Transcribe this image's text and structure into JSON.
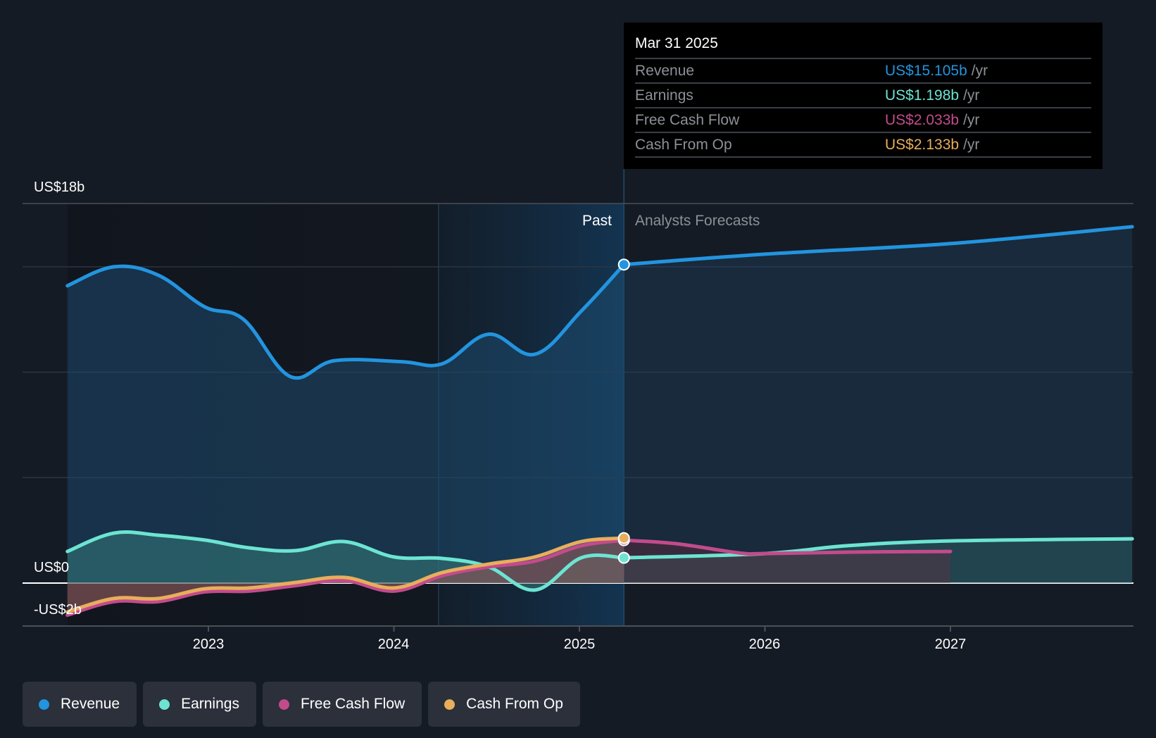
{
  "chart_data": {
    "type": "area",
    "title": "",
    "xlabel": "",
    "ylabel": "",
    "ylim": [
      -2,
      18
    ],
    "xlim": [
      2022.24,
      2027.98
    ],
    "y_ticks": [
      {
        "value": 18,
        "label": "US$18b"
      },
      {
        "value": 0,
        "label": "US$0"
      },
      {
        "value": -2,
        "label": "-US$2b"
      }
    ],
    "gridlines": [
      15,
      10,
      5
    ],
    "x_ticks": [
      {
        "value": 2023,
        "label": "2023"
      },
      {
        "value": 2024,
        "label": "2024"
      },
      {
        "value": 2025,
        "label": "2025"
      },
      {
        "value": 2026,
        "label": "2026"
      },
      {
        "value": 2027,
        "label": "2027"
      }
    ],
    "past_label": "Past",
    "forecast_label": "Analysts Forecasts",
    "past_end": 2025.24,
    "highlight_start": 2024.24,
    "legend_position": "bottom-left",
    "series": [
      {
        "name": "Revenue",
        "color": "#2394df",
        "past": [
          [
            2022.24,
            14.1
          ],
          [
            2022.49,
            15.0
          ],
          [
            2022.73,
            14.6
          ],
          [
            2022.98,
            13.1
          ],
          [
            2023.19,
            12.5
          ],
          [
            2023.44,
            9.8
          ],
          [
            2023.68,
            10.55
          ],
          [
            2024.04,
            10.5
          ],
          [
            2024.26,
            10.4
          ],
          [
            2024.51,
            11.8
          ],
          [
            2024.76,
            10.85
          ],
          [
            2025.01,
            12.9
          ],
          [
            2025.24,
            15.105
          ]
        ],
        "forecast": [
          [
            2025.24,
            15.105
          ],
          [
            2026.0,
            15.6
          ],
          [
            2027.0,
            16.1
          ],
          [
            2027.98,
            16.9
          ]
        ]
      },
      {
        "name": "Earnings",
        "color": "#6de4d2",
        "past": [
          [
            2022.24,
            1.5
          ],
          [
            2022.49,
            2.37
          ],
          [
            2022.73,
            2.27
          ],
          [
            2022.98,
            2.04
          ],
          [
            2023.22,
            1.67
          ],
          [
            2023.47,
            1.54
          ],
          [
            2023.73,
            1.97
          ],
          [
            2024.0,
            1.24
          ],
          [
            2024.26,
            1.17
          ],
          [
            2024.51,
            0.77
          ],
          [
            2024.76,
            -0.33
          ],
          [
            2025.01,
            1.2
          ],
          [
            2025.24,
            1.198
          ]
        ],
        "forecast": [
          [
            2025.24,
            1.198
          ],
          [
            2026.0,
            1.4
          ],
          [
            2026.44,
            1.77
          ],
          [
            2027.0,
            2.0
          ],
          [
            2027.98,
            2.1
          ]
        ]
      },
      {
        "name": "Free Cash Flow",
        "color": "#c24b8c",
        "past": [
          [
            2022.24,
            -1.52
          ],
          [
            2022.49,
            -0.88
          ],
          [
            2022.73,
            -0.88
          ],
          [
            2022.98,
            -0.42
          ],
          [
            2023.22,
            -0.38
          ],
          [
            2023.47,
            -0.12
          ],
          [
            2023.73,
            0.12
          ],
          [
            2024.0,
            -0.38
          ],
          [
            2024.26,
            0.35
          ],
          [
            2024.51,
            0.77
          ],
          [
            2024.76,
            1.04
          ],
          [
            2025.01,
            1.77
          ],
          [
            2025.24,
            2.033
          ]
        ],
        "forecast": [
          [
            2025.24,
            2.033
          ],
          [
            2025.52,
            1.87
          ],
          [
            2025.86,
            1.43
          ],
          [
            2026.0,
            1.4
          ],
          [
            2026.47,
            1.47
          ],
          [
            2027.0,
            1.5
          ]
        ]
      },
      {
        "name": "Cash From Op",
        "color": "#e8ae5c",
        "past": [
          [
            2022.24,
            -1.37
          ],
          [
            2022.49,
            -0.73
          ],
          [
            2022.73,
            -0.73
          ],
          [
            2022.98,
            -0.27
          ],
          [
            2023.22,
            -0.23
          ],
          [
            2023.47,
            0.03
          ],
          [
            2023.73,
            0.27
          ],
          [
            2024.0,
            -0.23
          ],
          [
            2024.26,
            0.5
          ],
          [
            2024.51,
            0.9
          ],
          [
            2024.76,
            1.24
          ],
          [
            2025.01,
            1.97
          ],
          [
            2025.24,
            2.133
          ]
        ],
        "forecast": []
      }
    ]
  },
  "tooltip": {
    "date": "Mar 31 2025",
    "rows": [
      {
        "label": "Revenue",
        "value": "US$15.105b",
        "unit": "/yr",
        "color": "#2394df"
      },
      {
        "label": "Earnings",
        "value": "US$1.198b",
        "unit": "/yr",
        "color": "#6de4d2"
      },
      {
        "label": "Free Cash Flow",
        "value": "US$2.033b",
        "unit": "/yr",
        "color": "#c24b8c"
      },
      {
        "label": "Cash From Op",
        "value": "US$2.133b",
        "unit": "/yr",
        "color": "#e8ae5c"
      }
    ]
  },
  "legend": {
    "items": [
      {
        "label": "Revenue",
        "color": "#2394df"
      },
      {
        "label": "Earnings",
        "color": "#6de4d2"
      },
      {
        "label": "Free Cash Flow",
        "color": "#c24b8c"
      },
      {
        "label": "Cash From Op",
        "color": "#e8ae5c"
      }
    ]
  }
}
